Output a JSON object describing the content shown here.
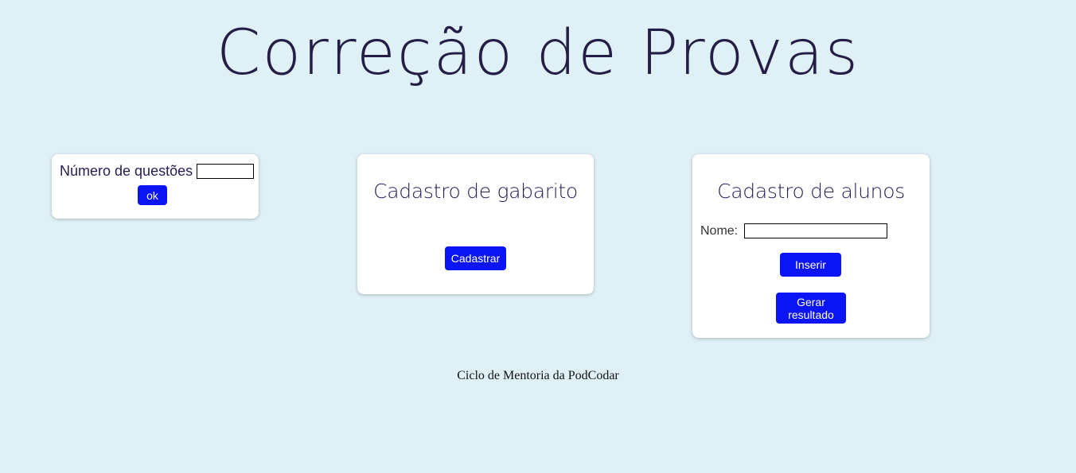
{
  "header": {
    "title": "Correção de Provas"
  },
  "questoes": {
    "label": "Número de questões",
    "input_value": "",
    "ok_label": "ok"
  },
  "gabarito": {
    "heading": "Cadastro de gabarito",
    "cadastrar_label": "Cadastrar"
  },
  "alunos": {
    "heading": "Cadastro de alunos",
    "nome_label": "Nome:",
    "nome_value": "",
    "inserir_label": "Inserir",
    "gerar_label": "Gerar resultado"
  },
  "footer": {
    "text": "Ciclo de Mentoria da PodCodar"
  },
  "colors": {
    "background": "#dff1f7",
    "title": "#241d45",
    "button": "#0a14f5",
    "card": "#ffffff"
  }
}
